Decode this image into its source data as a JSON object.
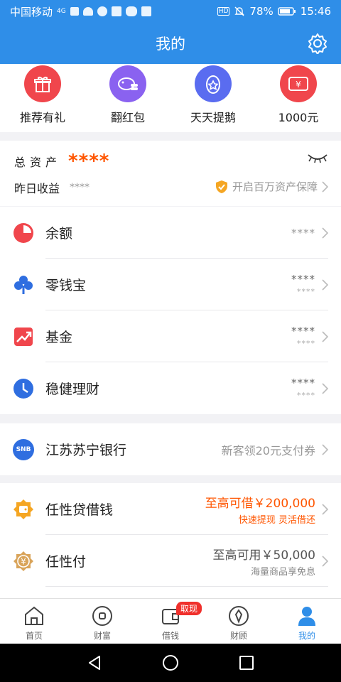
{
  "status_bar": {
    "carrier": "中国移动",
    "network": "4G",
    "battery": "78%",
    "time": "15:46",
    "hd_badge": "HD"
  },
  "header": {
    "title": "我的"
  },
  "quick_actions": [
    {
      "label": "推荐有礼",
      "icon": "gift-icon",
      "color": "#f0464c"
    },
    {
      "label": "翻红包",
      "icon": "piggy-bank-icon",
      "color": "#8a62f0"
    },
    {
      "label": "天天提鹅",
      "icon": "goose-egg-icon",
      "color": "#5a6cf0"
    },
    {
      "label": "1000元",
      "icon": "voucher-icon",
      "color": "#f0464c"
    }
  ],
  "assets": {
    "total_label": "总资产",
    "total_value": "****",
    "yesterday_label": "昨日收益",
    "yesterday_value": "****",
    "protection_text": "开启百万资产保障"
  },
  "finance_list": [
    {
      "name": "余额",
      "icon": "pie-chart-icon",
      "value": "****",
      "sub": ""
    },
    {
      "name": "零钱宝",
      "icon": "clover-icon",
      "value": "****",
      "sub": "****"
    },
    {
      "name": "基金",
      "icon": "trend-up-icon",
      "value": "****",
      "sub": "****"
    },
    {
      "name": "稳健理财",
      "icon": "clock-icon",
      "value": "****",
      "sub": "****"
    }
  ],
  "bank": {
    "name": "江苏苏宁银行",
    "logo_text": "SNB",
    "promo": "新客领20元支付券"
  },
  "credit_list": [
    {
      "name": "任性贷借钱",
      "icon": "wallet-icon",
      "main": "至高可借￥200,000",
      "sub": "快速提现 灵活借还",
      "accent": "orange"
    },
    {
      "name": "任性付",
      "icon": "yen-badge-icon",
      "main": "至高可用￥50,000",
      "sub": "海量商品享免息",
      "accent": "gray"
    }
  ],
  "tabs": [
    {
      "label": "首页",
      "icon": "home-icon"
    },
    {
      "label": "财富",
      "icon": "wealth-icon"
    },
    {
      "label": "借钱",
      "icon": "borrow-icon",
      "badge": "取现"
    },
    {
      "label": "财顾",
      "icon": "advisor-icon"
    },
    {
      "label": "我的",
      "icon": "profile-icon",
      "active": true
    }
  ],
  "colors": {
    "primary": "#2f8ee8",
    "accent": "#ff5500"
  }
}
